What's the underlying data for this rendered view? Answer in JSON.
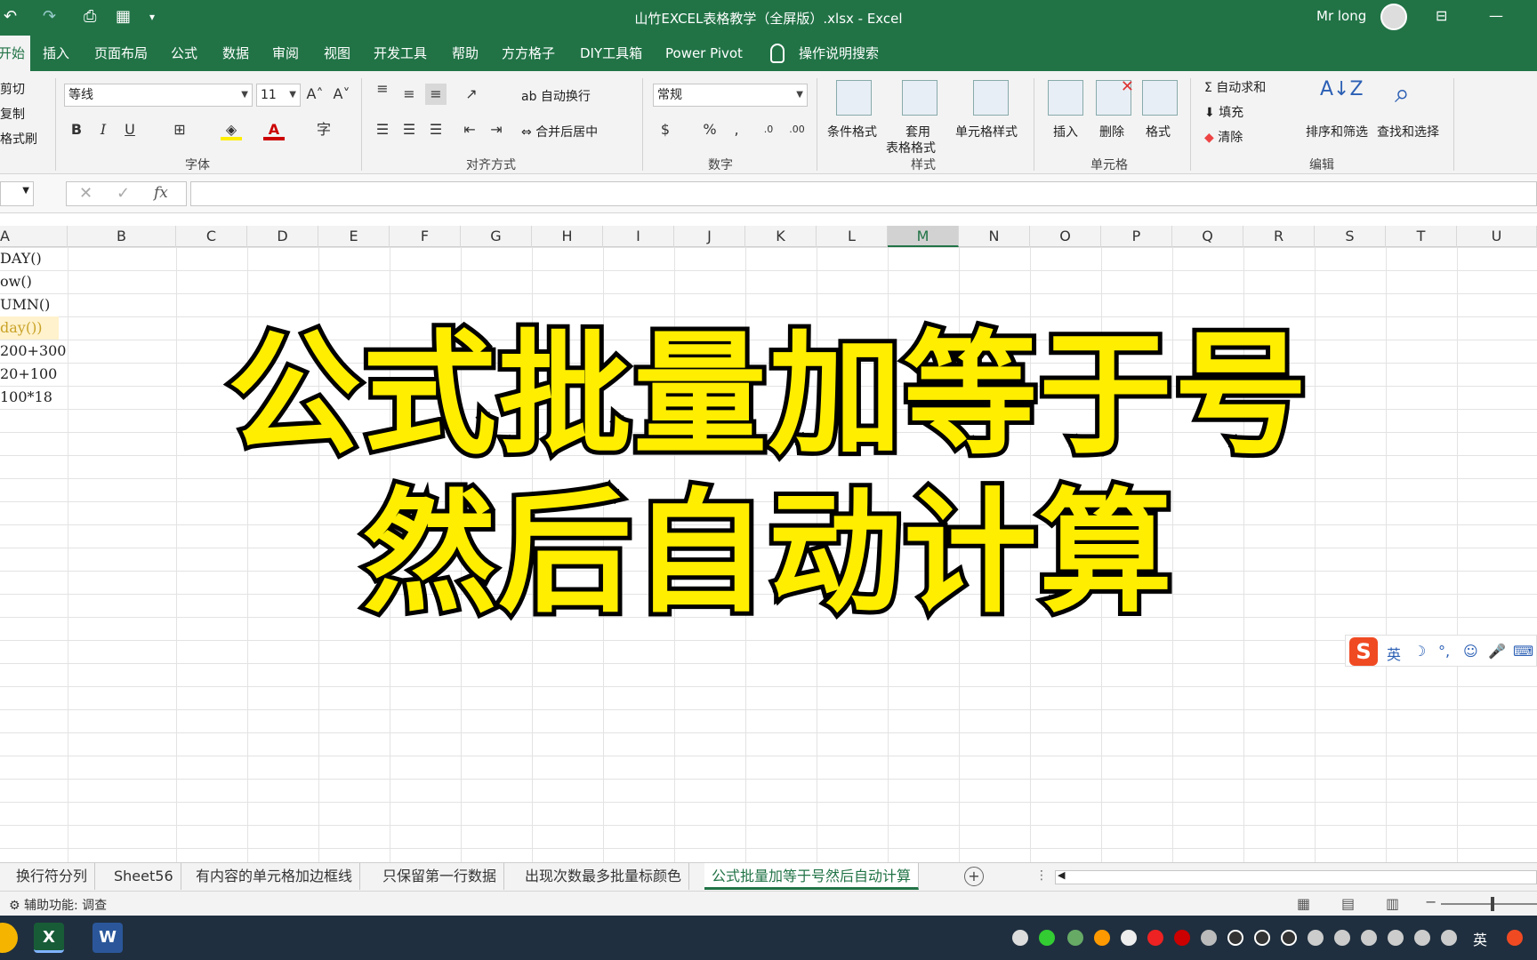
{
  "titlebar": {
    "title": "山竹EXCEL表格教学（全屏版）.xlsx  -  Excel",
    "user": "Mr long",
    "icons": [
      "undo-icon",
      "redo-icon",
      "print-preview-icon",
      "table-icon",
      "customize-icon",
      "ribbon-display-icon",
      "minimize-icon"
    ]
  },
  "tabs": [
    "开始",
    "插入",
    "页面布局",
    "公式",
    "数据",
    "审阅",
    "视图",
    "开发工具",
    "帮助",
    "方方格子",
    "DIY工具箱",
    "Power Pivot",
    "操作说明搜索"
  ],
  "ribbon": {
    "clipboard": {
      "cut": "剪切",
      "copy": "复制",
      "format_painter": "格式刷"
    },
    "font": {
      "name": "等线",
      "size": "11",
      "group_label": "字体"
    },
    "alignment": {
      "wrap": "自动换行",
      "merge": "合并后居中",
      "group_label": "对齐方式"
    },
    "number": {
      "format": "常规",
      "group_label": "数字"
    },
    "styles": {
      "conditional": "条件格式",
      "table_fmt_1": "套用",
      "table_fmt_2": "表格格式",
      "cell_styles": "单元格样式",
      "group_label": "样式"
    },
    "cells": {
      "insert": "插入",
      "delete": "删除",
      "format": "格式",
      "group_label": "单元格"
    },
    "editing": {
      "autosum": "自动求和",
      "fill": "填充",
      "clear": "清除",
      "sort": "排序和筛选",
      "find": "查找和选择",
      "group_label": "编辑"
    }
  },
  "formula_bar": {
    "fx": "fx",
    "value": ""
  },
  "columns": [
    "A",
    "B",
    "C",
    "D",
    "E",
    "F",
    "G",
    "H",
    "I",
    "J",
    "K",
    "L",
    "M",
    "N",
    "O",
    "P",
    "Q",
    "R",
    "S",
    "T",
    "U"
  ],
  "selected_column": "M",
  "cells_col_a": [
    "DAY()",
    "ow()",
    "UMN()",
    "day())",
    "200+300",
    "20+100",
    "100*18"
  ],
  "overlay": {
    "line1": "公式批量加等于号",
    "line2": "然后自动计算"
  },
  "ime": {
    "mode": "英"
  },
  "sheets": [
    "换行符分列",
    "Sheet56",
    "有内容的单元格加边框线",
    "只保留第一行数据",
    "出现次数最多批量标颜色",
    "公式批量加等于号然后自动计算"
  ],
  "active_sheet": "公式批量加等于号然后自动计算",
  "status": {
    "accessibility": "辅助功能: 调查"
  },
  "taskbar": {
    "ime": "英",
    "apps": [
      "chrome-icon",
      "excel-icon",
      "word-icon"
    ]
  },
  "colors": {
    "excel_green": "#217346",
    "headline_yellow": "#ffee00"
  }
}
